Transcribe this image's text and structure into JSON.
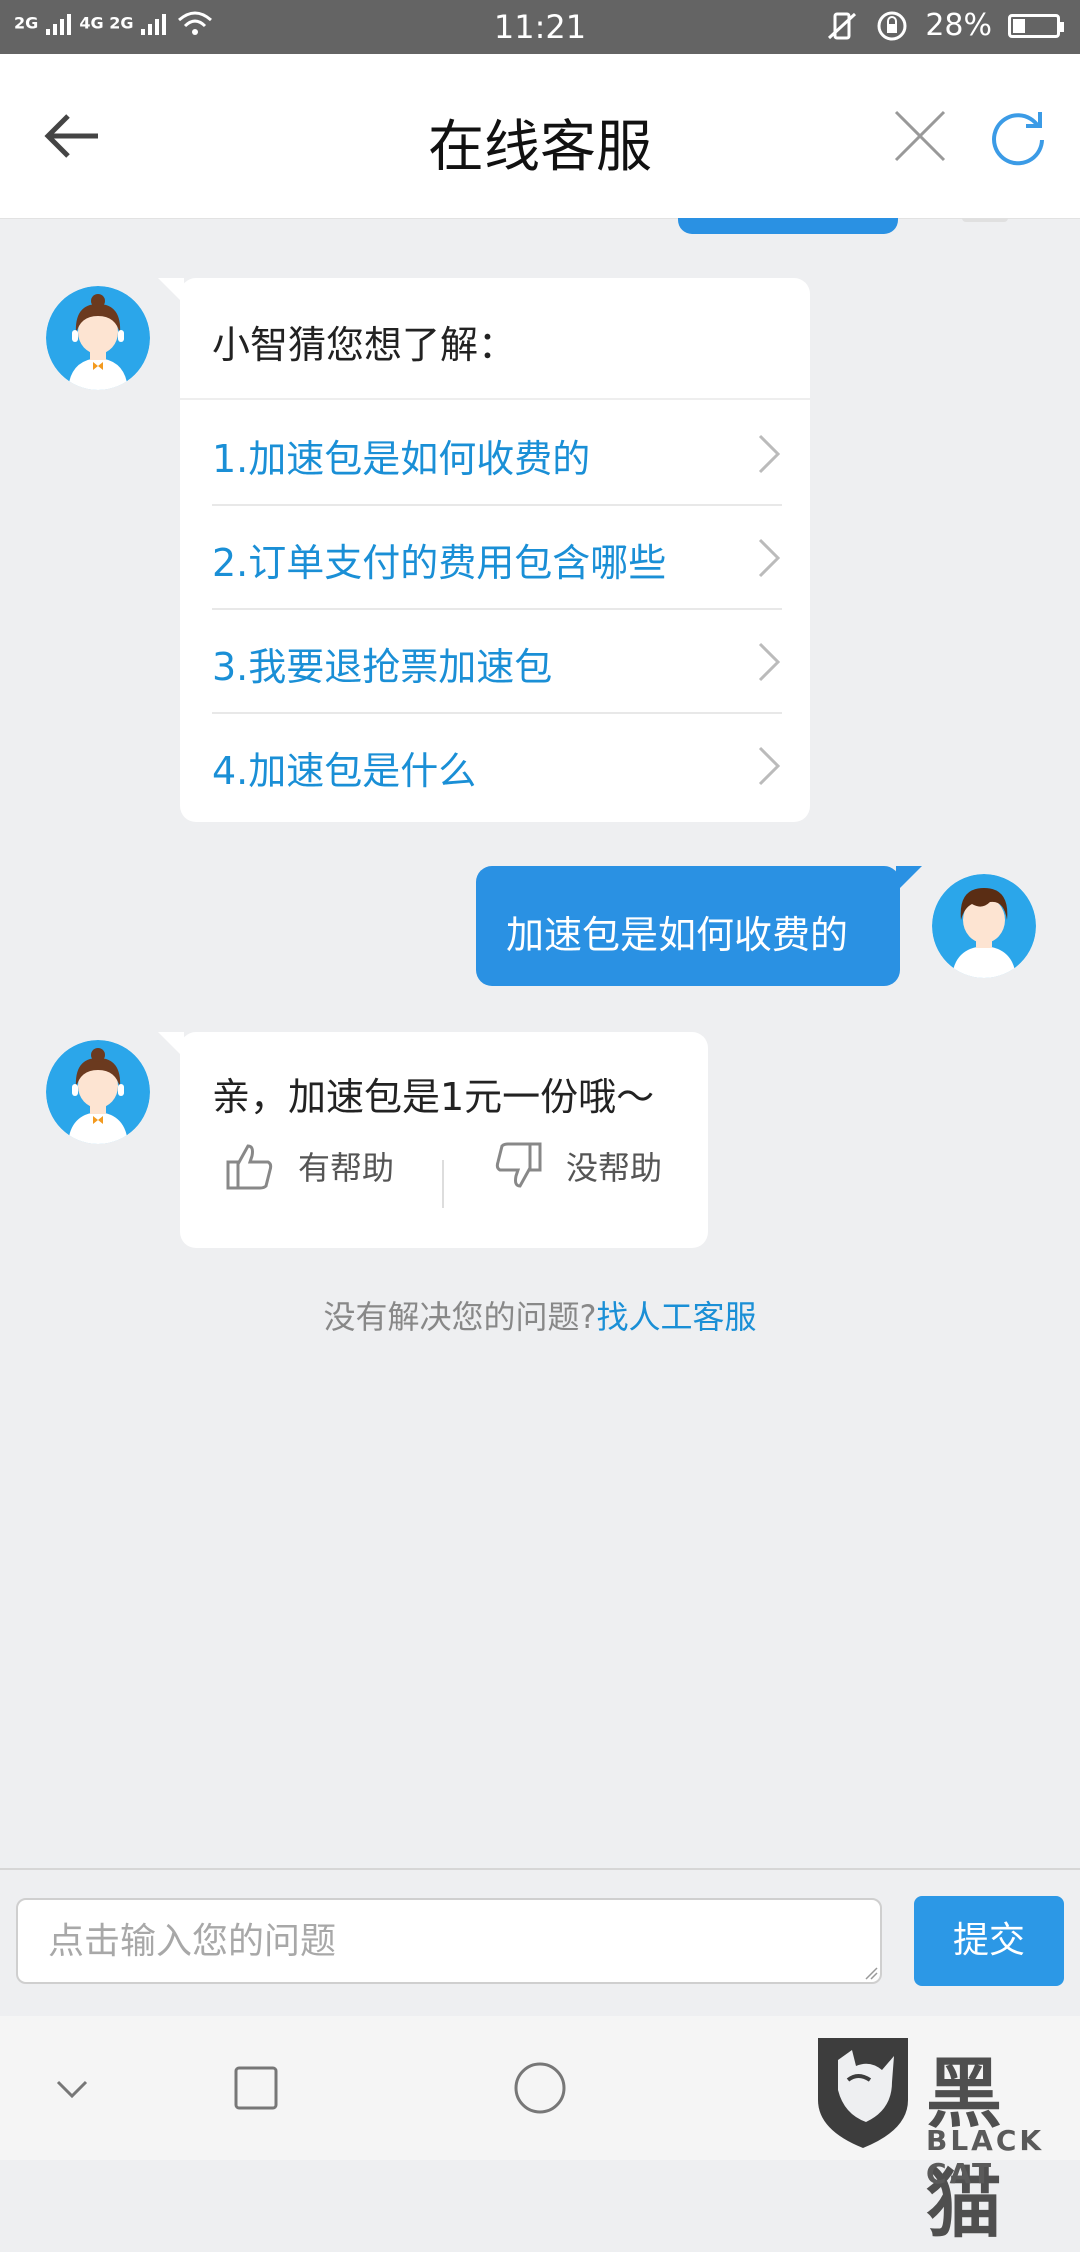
{
  "status_bar": {
    "signal1": "2G",
    "signal2": "4G",
    "signal3": "2G",
    "time": "11:21",
    "battery": "28%"
  },
  "header": {
    "title": "在线客服"
  },
  "bot_menu": {
    "lead": "小智猜您想了解：",
    "options": [
      "1.加速包是如何收费的",
      "2.订单支付的费用包含哪些",
      "3.我要退抢票加速包",
      "4.加速包是什么"
    ]
  },
  "user_message": "加速包是如何收费的",
  "bot_reply": {
    "text": "亲，加速包是1元一份哦～",
    "helpful": "有帮助",
    "not_helpful": "没帮助"
  },
  "hint": {
    "text": "没有解决您的问题?",
    "link": "找人工客服"
  },
  "input": {
    "placeholder": "点击输入您的问题",
    "submit": "提交"
  },
  "watermark": {
    "cn": "黑猫",
    "en": "BLACK CAT"
  }
}
